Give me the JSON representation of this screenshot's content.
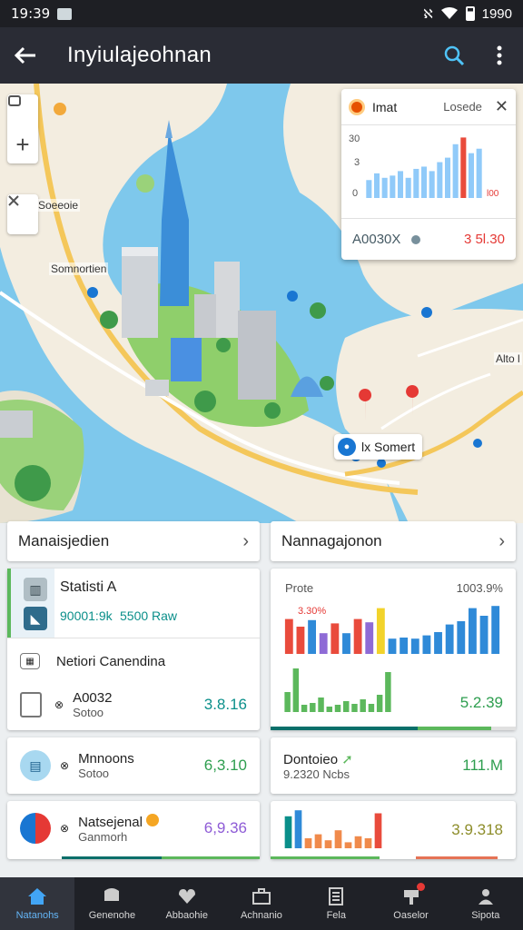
{
  "status_bar": {
    "time": "19:39",
    "battery": "1990"
  },
  "app_bar": {
    "title": "Inyiulajeohnan"
  },
  "map": {
    "labels": {
      "label1": "Soeeoie",
      "label2": "Somnortien",
      "label3": "Alto l"
    },
    "poi": "lx Somert",
    "zoom_in": "+",
    "overlay": {
      "title": "Imat",
      "close_label": "Losede",
      "y_ticks": [
        "30",
        "3",
        "0"
      ],
      "x_tick": "l00",
      "code": "A0030X",
      "value": "3 5l.30"
    }
  },
  "left_card_top": {
    "title": "Manaisjedien"
  },
  "right_card_top": {
    "title": "Nannagajonon"
  },
  "left_panel": {
    "stat": {
      "title": "Statisti A",
      "value1": "90001:9k",
      "value2": "5500 Raw"
    },
    "row2": {
      "title": "Netiori Canendina"
    },
    "row3": {
      "title": "A0032",
      "sub": "Sotoo",
      "value": "3.8.16"
    }
  },
  "right_panel": {
    "top_label": "Prote",
    "top_value": "1003.9%",
    "chart_label": "3.30%",
    "value": "5.2.39"
  },
  "mid_left": {
    "title": "Mnnoons",
    "sub": "Sotoo",
    "value": "6,3.10"
  },
  "mid_right": {
    "title": "Dontoieo",
    "sub": "9.2320 Ncbs",
    "value": "111.M"
  },
  "low_left": {
    "title": "Natsejenal",
    "sub": "Ganmorh",
    "value": "6,9.36"
  },
  "low_right": {
    "value": "3.9.318"
  },
  "colors": {
    "blue": "#2f8ad8",
    "red": "#e94b3c",
    "green": "#5cb85c",
    "yellow": "#f2d32b",
    "teal": "#0a8f8a"
  },
  "chart_data": [
    {
      "type": "bar",
      "series": [
        {
          "values": [
            8,
            11,
            9,
            10,
            12,
            9,
            13,
            14,
            12,
            16,
            18,
            24,
            27,
            20,
            22
          ]
        }
      ],
      "ylim": [
        0,
        30
      ],
      "y_tick_labels": [
        "30",
        "3",
        "0"
      ]
    },
    {
      "type": "bar",
      "series": [
        {
          "values": [
            32,
            25,
            31,
            19,
            28,
            19,
            32,
            29,
            42,
            14,
            15,
            14,
            17,
            20,
            27,
            30,
            42,
            35,
            44
          ]
        }
      ],
      "ylim": [
        0,
        50
      ]
    },
    {
      "type": "bar",
      "series": [
        {
          "values": [
            22,
            48,
            8,
            10,
            16,
            6,
            8,
            12,
            9,
            14,
            9,
            19,
            44
          ]
        }
      ],
      "ylim": [
        0,
        50
      ]
    },
    {
      "type": "bar",
      "series": [
        {
          "values": [
            32,
            38,
            10,
            14,
            8,
            18,
            6,
            12,
            10,
            35
          ]
        }
      ],
      "ylim": [
        0,
        40
      ]
    }
  ],
  "nav": [
    {
      "label": "Natanohs"
    },
    {
      "label": "Genenohe"
    },
    {
      "label": "Abbaohie"
    },
    {
      "label": "Achnanio"
    },
    {
      "label": "Fela"
    },
    {
      "label": "Oaselor"
    },
    {
      "label": "Sipota"
    }
  ]
}
